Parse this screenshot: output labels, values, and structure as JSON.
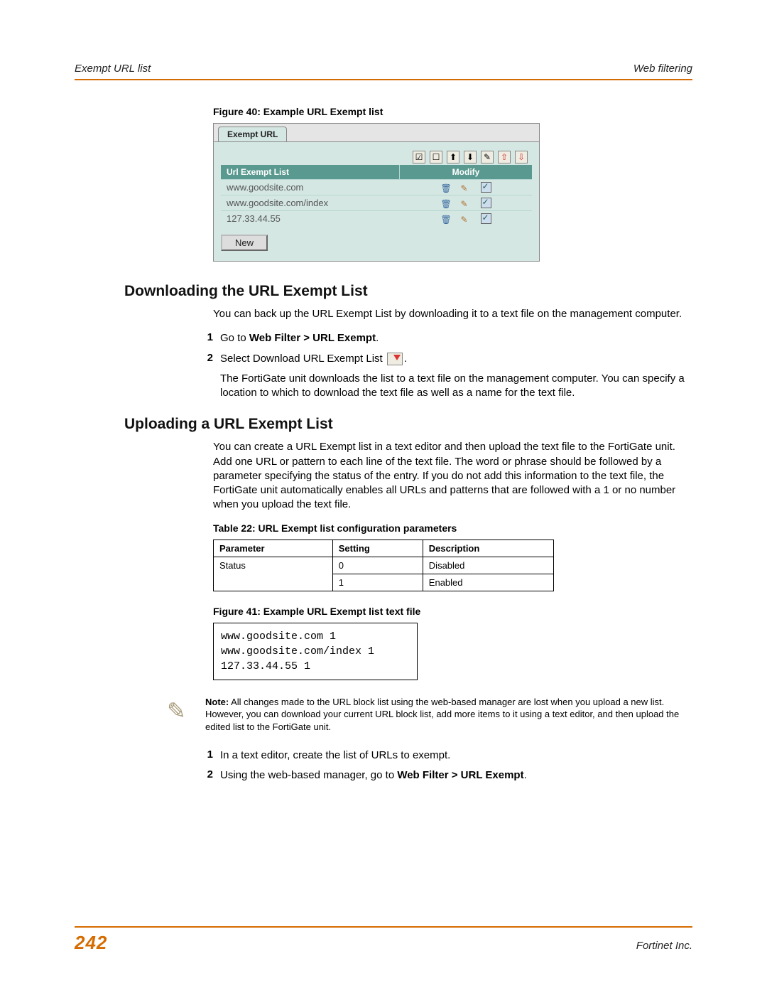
{
  "header": {
    "left": "Exempt URL list",
    "right": "Web filtering"
  },
  "figure40": {
    "caption": "Figure 40: Example URL Exempt list",
    "tab_label": "Exempt URL",
    "toolbar_icons": [
      "check-all-icon",
      "uncheck-all-icon",
      "upload-icon",
      "download-icon",
      "folder-icon",
      "export-up-icon",
      "export-down-icon"
    ],
    "cols": {
      "url": "Url Exempt List",
      "modify": "Modify"
    },
    "rows": [
      {
        "url": "www.goodsite.com"
      },
      {
        "url": "www.goodsite.com/index"
      },
      {
        "url": "127.33.44.55"
      }
    ],
    "new_btn": "New"
  },
  "h_download": "Downloading the URL Exempt List",
  "download_intro": "You can back up the URL Exempt List by downloading it to a text file on the management computer.",
  "dl_steps": {
    "s1_pre": "Go to ",
    "s1_bold": "Web Filter > URL Exempt",
    "s1_post": ".",
    "s2_pre": "Select Download URL Exempt List ",
    "s2_post": ".",
    "s2_cont": "The FortiGate unit downloads the list to a text file on the management computer. You can specify a location to which to download the text file as well as a name for the text file."
  },
  "h_upload": "Uploading a URL Exempt List",
  "upload_intro": "You can create a URL Exempt list in a text editor and then upload the text file to the FortiGate unit. Add one URL or pattern to each line of the text file. The word or phrase should be followed by a parameter specifying the status of the entry. If you do not add this information to the text file, the FortiGate unit automatically enables all URLs and patterns that are followed with a 1 or no number when you upload the text file.",
  "table22": {
    "caption": "Table 22: URL Exempt list configuration parameters",
    "head": {
      "param": "Parameter",
      "setting": "Setting",
      "desc": "Description"
    },
    "rows": [
      {
        "param": "Status",
        "setting": "0",
        "desc": "Disabled"
      },
      {
        "param": "",
        "setting": "1",
        "desc": "Enabled"
      }
    ]
  },
  "figure41": {
    "caption": "Figure 41: Example URL Exempt list text file",
    "lines": "www.goodsite.com 1\nwww.goodsite.com/index 1\n127.33.44.55 1"
  },
  "note": {
    "bold": "Note:",
    "text": " All changes made to the URL block list using the web-based manager are lost when you upload a new list. However, you can download your current URL block list, add more items to it using a text editor, and then upload the edited list to the FortiGate unit."
  },
  "ul_steps": {
    "s1": "In a text editor, create the list of URLs to exempt.",
    "s2_pre": "Using the web-based manager, go to ",
    "s2_bold": "Web Filter > URL Exempt",
    "s2_post": "."
  },
  "footer": {
    "page": "242",
    "company": "Fortinet Inc."
  }
}
